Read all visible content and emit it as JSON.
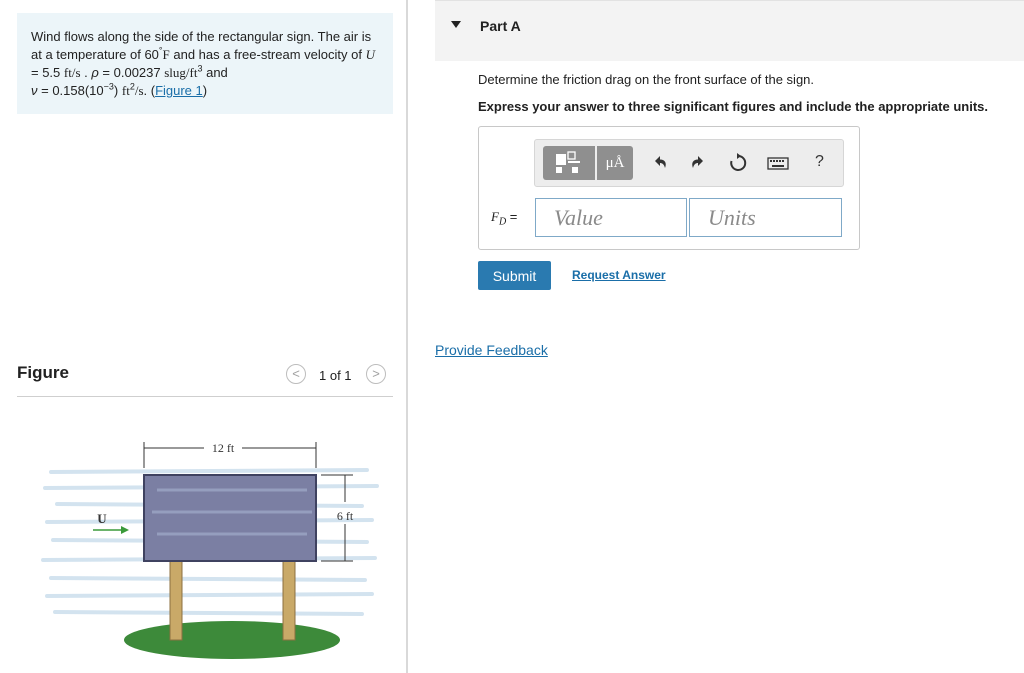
{
  "problem": {
    "text1": "Wind flows along the side of the rectangular sign. The air is at a temperature of 60",
    "deg": "°",
    "unitF": "F",
    "text2": " and has a free-stream velocity of ",
    "U": "U",
    "eqU": " = 5.5 ",
    "ftps": "ft/s",
    "dot": " . ",
    "rho": "ρ",
    "eqRho": " = 0.00237 ",
    "slugft": "slug/ft",
    "three": "3",
    "and": " and",
    "nu": "ν",
    "eqNu": " = 0.158(10",
    "minus3": "−3",
    "closeP": ") ",
    "ft": "ft",
    "two": "2",
    "perS": "/s",
    "dot2": ". (",
    "figLink": "Figure 1",
    "closeParen": ")"
  },
  "figure": {
    "title": "Figure",
    "pager": "1 of 1",
    "prev": "<",
    "next": ">",
    "width_label": "12 ft",
    "height_label": "6 ft",
    "wind_label": "U"
  },
  "partA": {
    "title": "Part A",
    "question": "Determine the friction drag on the front surface of the sign.",
    "instruction": "Express your answer to three significant figures and include the appropriate units.",
    "unit_symbol": "μÅ",
    "help": "?",
    "fd_label_F": "F",
    "fd_label_D": "D",
    "fd_eq": " =",
    "value_placeholder": "Value",
    "units_placeholder": "Units",
    "submit": "Submit",
    "request_answer": "Request Answer"
  },
  "feedback": "Provide Feedback",
  "colors": {
    "accent": "#2a7ab0",
    "link": "#1a6ea8",
    "problem_bg": "#ecf5f9"
  },
  "icons": [
    "templates-icon",
    "units-icon",
    "undo-icon",
    "redo-icon",
    "reset-icon",
    "keyboard-icon",
    "help-icon"
  ]
}
